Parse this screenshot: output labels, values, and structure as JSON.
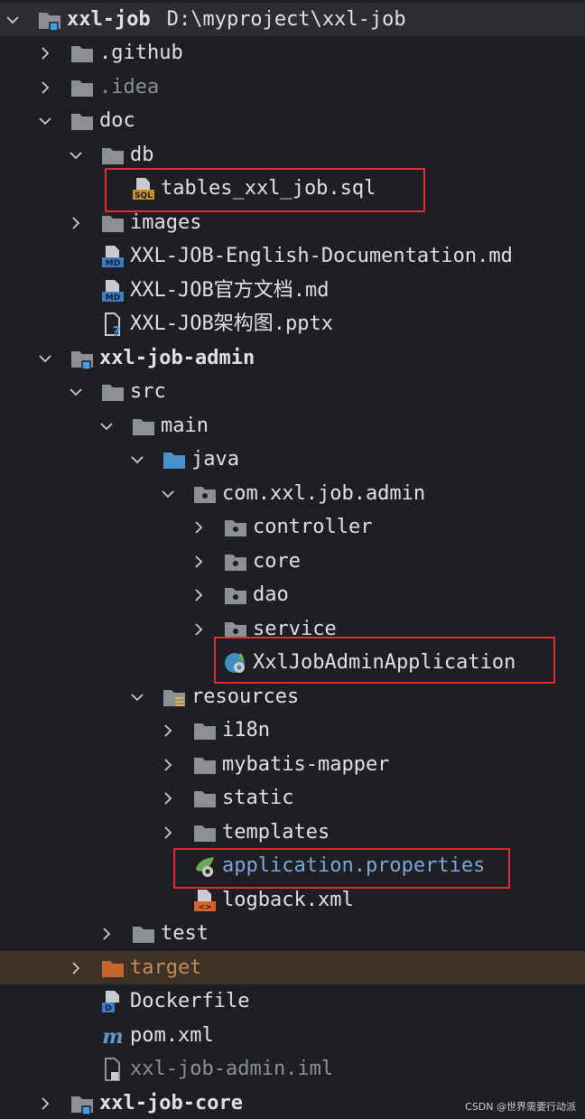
{
  "project": {
    "name": "xxl-job",
    "path": "D:\\myproject\\xxl-job"
  },
  "items": {
    "github": ".github",
    "idea": ".idea",
    "doc": "doc",
    "db": "db",
    "tables_sql": "tables_xxl_job.sql",
    "images": "images",
    "md_english": "XXL-JOB-English-Documentation.md",
    "md_chinese": "XXL-JOB官方文档.md",
    "pptx": "XXL-JOB架构图.pptx",
    "admin_module": "xxl-job-admin",
    "src": "src",
    "main": "main",
    "java": "java",
    "package": "com.xxl.job.admin",
    "controller": "controller",
    "core": "core",
    "dao": "dao",
    "service": "service",
    "app_class": "XxlJobAdminApplication",
    "resources": "resources",
    "i18n": "i18n",
    "mybatis": "mybatis-mapper",
    "static": "static",
    "templates": "templates",
    "app_props": "application.properties",
    "logback": "logback.xml",
    "test": "test",
    "target": "target",
    "dockerfile": "Dockerfile",
    "pom": "pom.xml",
    "iml": "xxl-job-admin.iml",
    "core_module": "xxl-job-core"
  },
  "watermark": "CSDN @世界需要行动派",
  "colors": {
    "background": "#1e1f22",
    "folder": "#8c8f94",
    "source_folder": "#4a90c9",
    "excluded_folder": "#c5652e",
    "highlight": "#e52a2f"
  },
  "icons": {
    "folder": "folder-icon",
    "module": "module-icon",
    "package": "package-icon",
    "sql": "sql-file-icon",
    "markdown": "markdown-file-icon",
    "unknown": "unknown-file-icon",
    "spring_boot": "spring-boot-class-icon",
    "spring_props": "spring-properties-icon",
    "xml": "xml-file-icon",
    "docker": "dockerfile-icon",
    "maven": "maven-icon",
    "iml": "iml-file-icon"
  }
}
